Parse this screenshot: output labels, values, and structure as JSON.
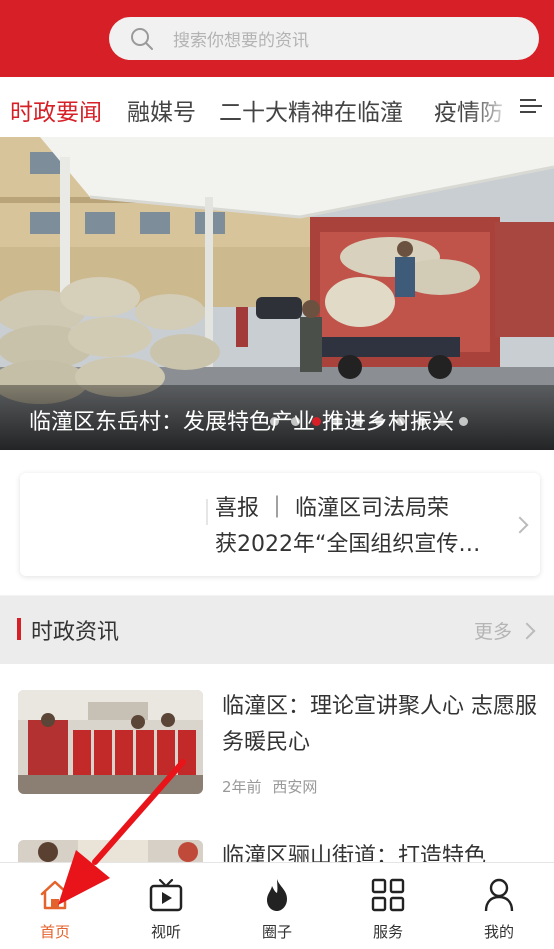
{
  "search": {
    "placeholder": "搜索你想要的资讯",
    "icon": "search-icon"
  },
  "tabs": [
    {
      "label": "时政要闻",
      "active": true
    },
    {
      "label": "融媒号"
    },
    {
      "label": "二十大精神在临潼"
    },
    {
      "label": "疫情防"
    }
  ],
  "banner": {
    "title": "临潼区东岳村：发展特色产业  推进乡村振兴",
    "dot_count": 10,
    "active_dot": 1
  },
  "notice": {
    "line1": "喜报  ｜  临潼区司法局荣",
    "line2": "获2022年“全国组织宣传…"
  },
  "section": {
    "title": "时政资讯",
    "more": "更多"
  },
  "news": [
    {
      "title": "临潼区：理论宣讲聚人心  志愿服务暖民心",
      "time": "2年前",
      "source": "西安网"
    },
    {
      "title": "临潼区骊山街道：打造特色"
    }
  ],
  "bottom_nav": [
    {
      "label": "首页",
      "icon": "home-icon",
      "active": true
    },
    {
      "label": "视听",
      "icon": "video-icon"
    },
    {
      "label": "圈子",
      "icon": "flame-icon"
    },
    {
      "label": "服务",
      "icon": "grid-icon"
    },
    {
      "label": "我的",
      "icon": "user-icon"
    }
  ],
  "colors": {
    "brand": "#d61f26",
    "active_nav": "#e4632c"
  }
}
